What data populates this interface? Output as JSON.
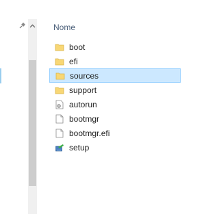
{
  "header": {
    "column_name": "Nome"
  },
  "files": [
    {
      "name": "boot",
      "icon": "folder-icon",
      "selected": false
    },
    {
      "name": "efi",
      "icon": "folder-icon",
      "selected": false
    },
    {
      "name": "sources",
      "icon": "folder-icon",
      "selected": true
    },
    {
      "name": "support",
      "icon": "folder-icon",
      "selected": false
    },
    {
      "name": "autorun",
      "icon": "settings-file-icon",
      "selected": false
    },
    {
      "name": "bootmgr",
      "icon": "file-icon",
      "selected": false
    },
    {
      "name": "bootmgr.efi",
      "icon": "file-icon",
      "selected": false
    },
    {
      "name": "setup",
      "icon": "setup-app-icon",
      "selected": false
    }
  ],
  "colors": {
    "selection_bg": "#cce8ff",
    "selection_border": "#99d1ff",
    "folder": "#f8d775",
    "header_text": "#4c607a"
  }
}
